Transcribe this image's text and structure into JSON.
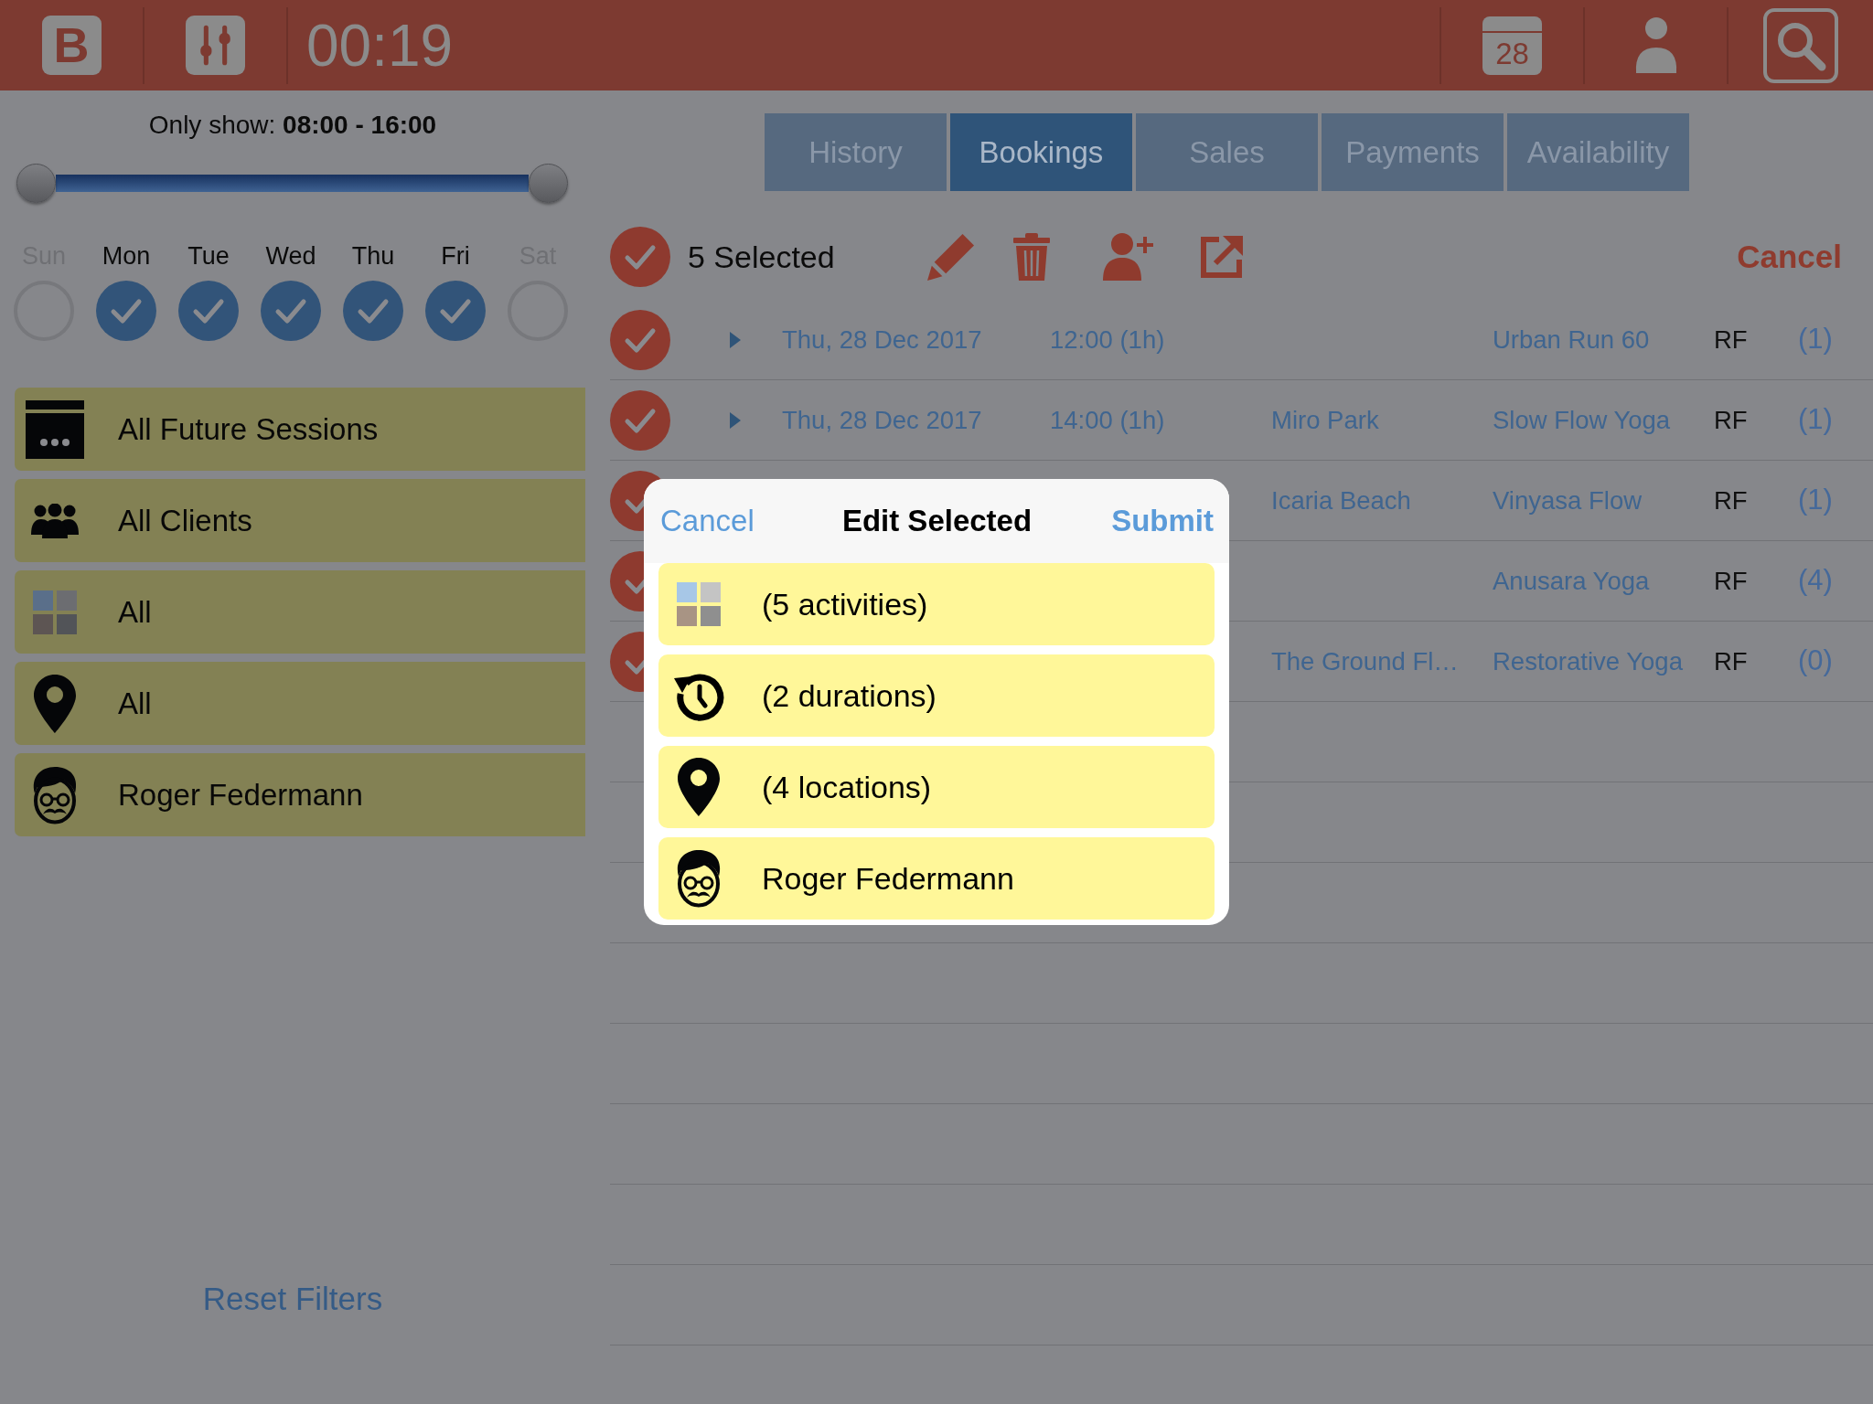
{
  "top_bar": {
    "logo": "B",
    "timer": "00:19",
    "calendar_day": "28"
  },
  "filters": {
    "time_range": {
      "label": "Only show: **08:00 - 16:00**",
      "level": 1
    },
    "days": [
      {
        "label": "Sun",
        "checked": false
      },
      {
        "label": "Mon",
        "checked": true
      },
      {
        "label": "Tue",
        "checked": true
      },
      {
        "label": "Wed",
        "checked": true
      },
      {
        "label": "Thu",
        "checked": true
      },
      {
        "label": "Fri",
        "checked": true
      },
      {
        "label": "Sat",
        "checked": false
      }
    ],
    "items": [
      {
        "kind": "sessions",
        "label": "All Future Sessions"
      },
      {
        "kind": "clients",
        "label": "All Clients"
      },
      {
        "kind": "activities",
        "label": "All"
      },
      {
        "kind": "locations",
        "label": "All"
      },
      {
        "kind": "instructor",
        "label": "Roger Federmann"
      }
    ],
    "reset": "Reset Filters"
  },
  "tabs": [
    {
      "label": "History",
      "selected": false
    },
    {
      "label": "Bookings",
      "selected": true
    },
    {
      "label": "Sales",
      "selected": false
    },
    {
      "label": "Payments",
      "selected": false
    },
    {
      "label": "Availability",
      "selected": false
    }
  ],
  "selection_bar": {
    "all_checked": true,
    "count_label": "5 Selected",
    "cancel": "Cancel"
  },
  "rows": [
    {
      "checked": true,
      "date": "Thu, 28 Dec 2017",
      "time": "12:00 (1h)",
      "activity": "Urban Run 60",
      "instructor": "RF",
      "count": "(1)"
    },
    {
      "checked": true,
      "date": "Thu, 28 Dec 2017",
      "time": "14:00 (1h)",
      "location": "Miro Park",
      "activity": "Slow Flow Yoga",
      "instructor": "RF",
      "count": "(1)"
    },
    {
      "checked": true,
      "location": "Icaria Beach",
      "activity": "Vinyasa Flow",
      "instructor": "RF",
      "count": "(1)"
    },
    {
      "checked": true,
      "activity": "Anusara Yoga",
      "instructor": "RF",
      "count": "(4)"
    },
    {
      "checked": true,
      "location": "The Ground Fl…",
      "activity": "Restorative Yoga",
      "instructor": "RF",
      "count": "(0)"
    }
  ],
  "edit_dialog": {
    "cancel": "Cancel",
    "title": "Edit Selected",
    "submit": "Submit",
    "items": [
      {
        "kind": "activities",
        "label": "(5 activities)"
      },
      {
        "kind": "durations",
        "label": "(2 durations)"
      },
      {
        "kind": "locations",
        "label": "(4 locations)"
      },
      {
        "kind": "instructor",
        "label": "Roger Federmann"
      }
    ]
  }
}
